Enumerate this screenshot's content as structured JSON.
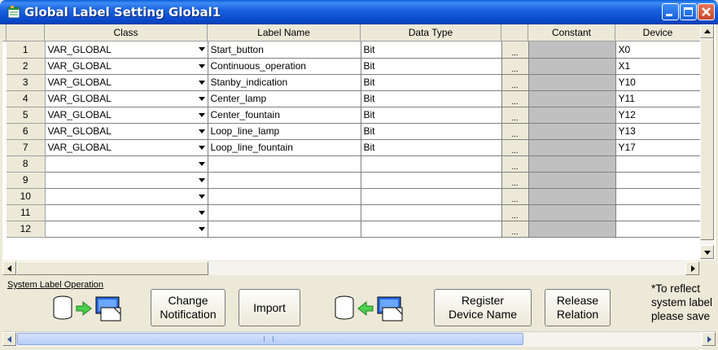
{
  "window": {
    "title": "Global Label Setting Global1"
  },
  "colors": {
    "titlebar": "#0a5fd8",
    "constant_cell": "#c0c0c0",
    "window_bg": "#ece9d8"
  },
  "table": {
    "headers": {
      "class": "Class",
      "label_name": "Label Name",
      "data_type": "Data Type",
      "constant": "Constant",
      "device": "Device"
    },
    "browse_label": "...",
    "rows": [
      {
        "num": "1",
        "class": "VAR_GLOBAL",
        "label": "Start_button",
        "type": "Bit",
        "constant": "",
        "device": "X0"
      },
      {
        "num": "2",
        "class": "VAR_GLOBAL",
        "label": "Continuous_operation",
        "type": "Bit",
        "constant": "",
        "device": "X1"
      },
      {
        "num": "3",
        "class": "VAR_GLOBAL",
        "label": "Stanby_indication",
        "type": "Bit",
        "constant": "",
        "device": "Y10"
      },
      {
        "num": "4",
        "class": "VAR_GLOBAL",
        "label": "Center_lamp",
        "type": "Bit",
        "constant": "",
        "device": "Y11"
      },
      {
        "num": "5",
        "class": "VAR_GLOBAL",
        "label": "Center_fountain",
        "type": "Bit",
        "constant": "",
        "device": "Y12"
      },
      {
        "num": "6",
        "class": "VAR_GLOBAL",
        "label": "Loop_line_lamp",
        "type": "Bit",
        "constant": "",
        "device": "Y13"
      },
      {
        "num": "7",
        "class": "VAR_GLOBAL",
        "label": "Loop_line_fountain",
        "type": "Bit",
        "constant": "",
        "device": "Y17"
      },
      {
        "num": "8",
        "class": "",
        "label": "",
        "type": "",
        "constant": "",
        "device": ""
      },
      {
        "num": "9",
        "class": "",
        "label": "",
        "type": "",
        "constant": "",
        "device": ""
      },
      {
        "num": "10",
        "class": "",
        "label": "",
        "type": "",
        "constant": "",
        "device": ""
      },
      {
        "num": "11",
        "class": "",
        "label": "",
        "type": "",
        "constant": "",
        "device": ""
      },
      {
        "num": "12",
        "class": "",
        "label": "",
        "type": "",
        "constant": "",
        "device": ""
      }
    ]
  },
  "system_label": {
    "section_label": "System Label Operation",
    "change_notification": "Change\nNotification",
    "import": "Import",
    "register_device_name": "Register\nDevice Name",
    "release_relation": "Release\nRelation",
    "note": "*To reflect\nsystem label\nplease save"
  },
  "icons": {
    "title": "global-label-icon",
    "export": "database-to-computer-icon",
    "import": "computer-to-database-icon"
  }
}
